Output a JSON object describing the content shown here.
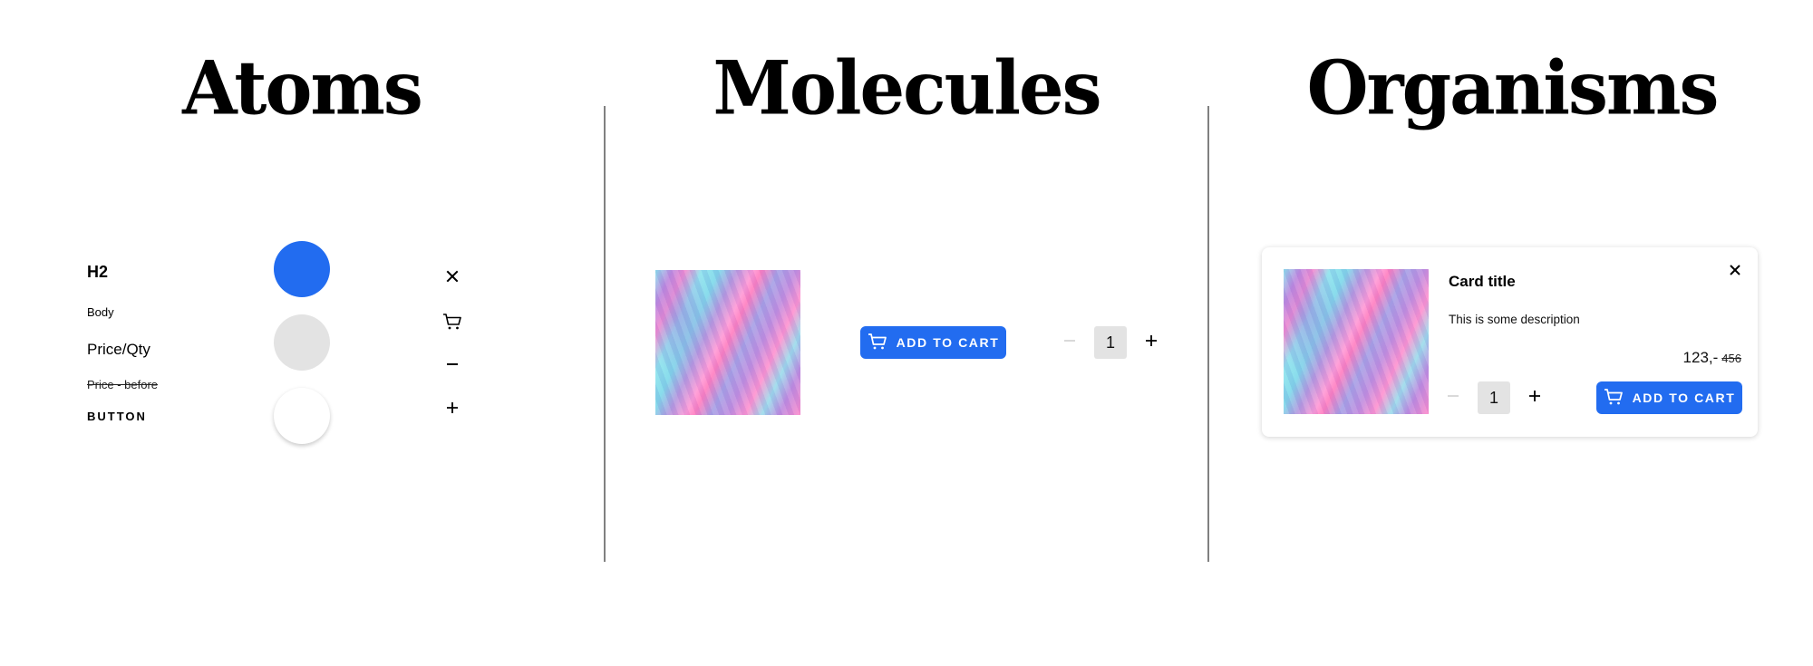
{
  "sections": {
    "atoms": "Atoms",
    "molecules": "Molecules",
    "organisms": "Organisms"
  },
  "atoms": {
    "typography": {
      "h2": "H2",
      "body": "Body",
      "price_qty": "Price/Qty",
      "price_before": "Price - before",
      "button": "BUTTON"
    },
    "colors": {
      "primary": "#226cf0",
      "grey": "#e3e3e3",
      "white": "#ffffff"
    },
    "icons": [
      "close-icon",
      "cart-icon",
      "minus-icon",
      "plus-icon"
    ]
  },
  "molecules": {
    "image_alt": "Pink and blue fluid art",
    "add_to_cart_label": "ADD TO CART",
    "quantity": "1"
  },
  "organisms": {
    "card": {
      "title": "Card title",
      "description": "This is some description",
      "price": "123,-",
      "price_before": "456",
      "quantity": "1",
      "add_to_cart_label": "ADD TO CART"
    }
  }
}
